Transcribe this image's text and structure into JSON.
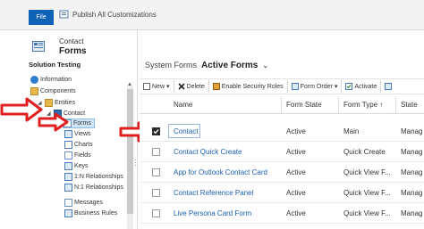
{
  "ribbon": {
    "file_label": "File",
    "publish_label": "Publish All Customizations"
  },
  "left_pane": {
    "entity_subtitle": "Contact",
    "entity_title": "Forms",
    "solution_title": "Solution Testing",
    "tree": [
      {
        "label": "Information",
        "icon": "info-icon"
      },
      {
        "label": "Components",
        "icon": "folder-icon"
      },
      {
        "label": "Entities",
        "icon": "folder-icon"
      },
      {
        "label": "Contact",
        "icon": "entity-icon"
      },
      {
        "label": "Forms",
        "icon": "form-icon"
      },
      {
        "label": "Views",
        "icon": "view-icon"
      },
      {
        "label": "Charts",
        "icon": "chart-icon"
      },
      {
        "label": "Fields",
        "icon": "field-icon"
      },
      {
        "label": "Keys",
        "icon": "key-icon"
      },
      {
        "label": "1:N Relationships",
        "icon": "relationship-icon"
      },
      {
        "label": "N:1 Relationships",
        "icon": "relationship-icon"
      },
      {
        "label": "Messages",
        "icon": "message-icon"
      },
      {
        "label": "Business Rules",
        "icon": "rule-icon"
      }
    ]
  },
  "main": {
    "breadcrumb_parent": "System Forms",
    "view_name": "Active Forms",
    "toolbar": [
      {
        "label": "New",
        "icon": "new-icon"
      },
      {
        "label": "Delete",
        "icon": "delete-icon"
      },
      {
        "label": "Enable Security Roles",
        "icon": "security-roles-icon"
      },
      {
        "label": "Form Order",
        "icon": "form-order-icon"
      },
      {
        "label": "Activate",
        "icon": "activate-icon"
      }
    ],
    "columns": [
      "Name",
      "Form State",
      "Form Type ↑",
      "State"
    ],
    "rows": [
      {
        "name": "Contact",
        "form_state": "Active",
        "form_type": "Main",
        "state": "Manag"
      },
      {
        "name": "Contact Quick Create",
        "form_state": "Active",
        "form_type": "Quick Create",
        "state": "Manag"
      },
      {
        "name": "App for Outlook Contact Card",
        "form_state": "Active",
        "form_type": "Quick View F...",
        "state": "Manag"
      },
      {
        "name": "Contact Reference Panel",
        "form_state": "Active",
        "form_type": "Quick View F...",
        "state": "Manag"
      },
      {
        "name": "Live Persona Card Form",
        "form_state": "Active",
        "form_type": "Quick View F...",
        "state": "Manag"
      }
    ]
  },
  "colors": {
    "file_blue": "#0f63b6",
    "link_blue": "#1a5fae",
    "annotation_red": "#e02020",
    "selected_tree": "#cfe5f7"
  }
}
